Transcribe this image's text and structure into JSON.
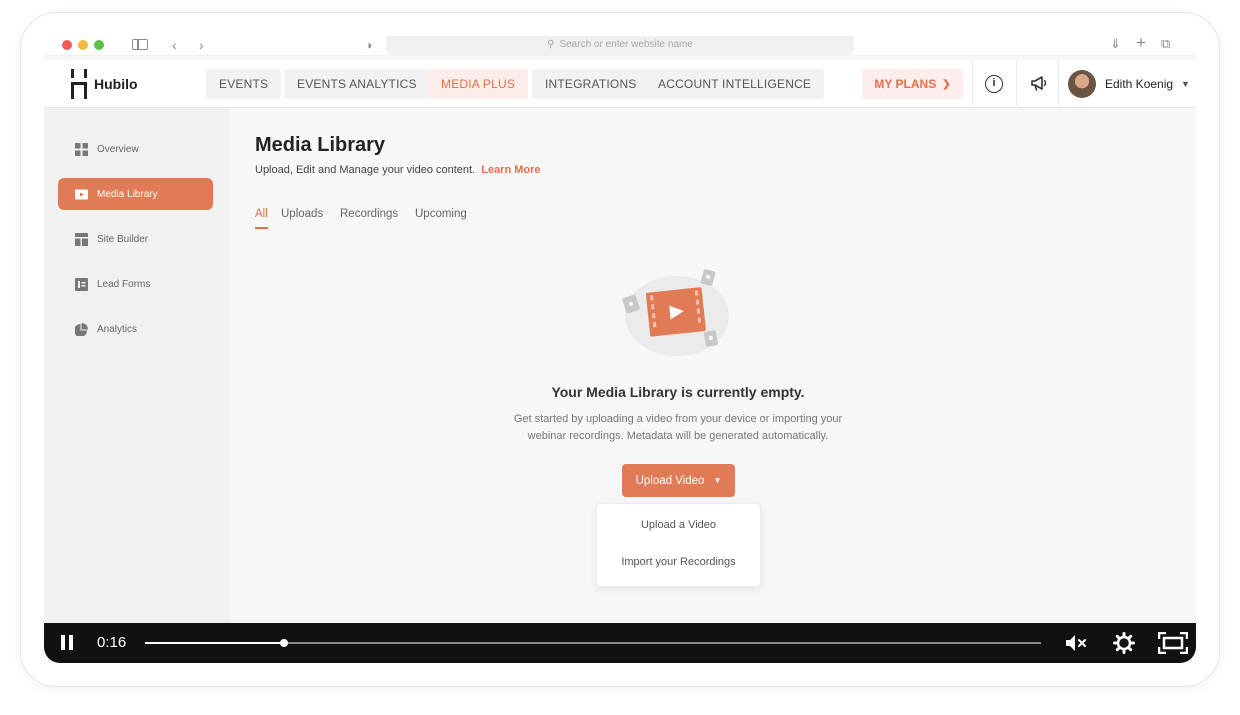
{
  "browser": {
    "search_placeholder": "Search or enter website name"
  },
  "brand": {
    "name": "Hubilo"
  },
  "nav": {
    "tabs": [
      {
        "label": "EVENTS"
      },
      {
        "label": "EVENTS ANALYTICS"
      },
      {
        "label": "MEDIA PLUS"
      },
      {
        "label": "INTEGRATIONS"
      },
      {
        "label": "ACCOUNT INTELLIGENCE"
      }
    ],
    "active_tab": "MEDIA PLUS",
    "my_plans": "MY PLANS",
    "user_name": "Edith Koenig"
  },
  "sidebar": {
    "items": [
      {
        "label": "Overview",
        "icon": "grid-icon"
      },
      {
        "label": "Media Library",
        "icon": "video-icon"
      },
      {
        "label": "Site Builder",
        "icon": "layout-icon"
      },
      {
        "label": "Lead Forms",
        "icon": "form-icon"
      },
      {
        "label": "Analytics",
        "icon": "pie-chart-icon"
      }
    ],
    "active": "Media Library"
  },
  "main": {
    "title": "Media Library",
    "subtitle": "Upload, Edit and Manage your video content.",
    "learn_more": "Learn More",
    "tabs": [
      {
        "label": "All"
      },
      {
        "label": "Uploads"
      },
      {
        "label": "Recordings"
      },
      {
        "label": "Upcoming"
      }
    ],
    "active_tab": "All",
    "empty_title": "Your Media Library is currently empty.",
    "empty_desc_line1": "Get started by uploading a video from your device or importing your",
    "empty_desc_line2": "webinar recordings. Metadata will be generated automatically.",
    "upload_button": "Upload Video",
    "dropdown": [
      {
        "label": "Upload a Video"
      },
      {
        "label": "Import your Recordings"
      }
    ]
  },
  "player": {
    "time": "0:16",
    "progress": 0.155
  },
  "colors": {
    "accent": "#e07b55",
    "accent_text": "#e0704a",
    "player_bg": "#111111"
  }
}
